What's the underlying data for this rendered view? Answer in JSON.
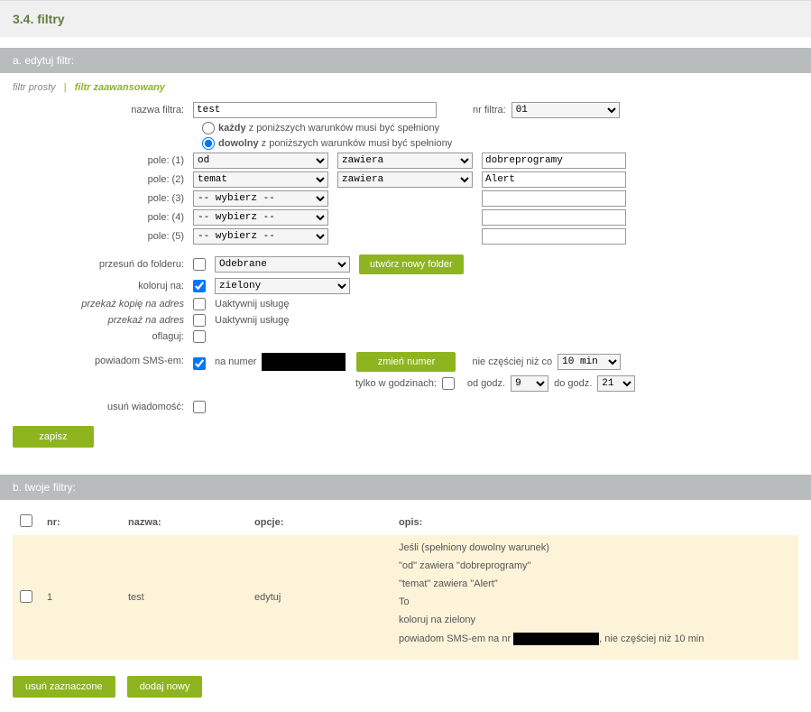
{
  "page": {
    "title": "3.4. filtry"
  },
  "sections": {
    "a_title": "a. edytuj filtr:",
    "b_title": "b. twoje filtry:"
  },
  "tabs": {
    "simple": "filtr prosty",
    "sep": "|",
    "advanced": "filtr zaawansowany"
  },
  "labels": {
    "filter_name": "nazwa filtra:",
    "filter_nr": "nr filtra:",
    "every": "każdy",
    "every_rest": " z poniższych warunków musi być spełniony",
    "any": "dowolny",
    "any_rest": " z poniższych warunków musi być spełniony",
    "field1": "pole: (1)",
    "field2": "pole: (2)",
    "field3": "pole: (3)",
    "field4": "pole: (4)",
    "field5": "pole: (5)",
    "move_to": "przesuń do folderu:",
    "color": "koloruj na:",
    "forward_copy": "przekaż kopię na adres",
    "forward": "przekaż na adres",
    "flag": "oflaguj:",
    "sms": "powiadom SMS-em:",
    "na_numer": "na numer",
    "tylko_godz": "tylko w godzinach:",
    "nie_czesciej": "nie częściej niż co",
    "od_godz": "od godz.",
    "do_godz": "do godz.",
    "delete_msg": "usuń wiadomość:",
    "activate": "Uaktywnij usługę"
  },
  "values": {
    "filter_name": "test",
    "filter_nr": "01",
    "field_opts": {
      "od": "od",
      "temat": "temat",
      "wybierz": "-- wybierz --"
    },
    "op_zawiera": "zawiera",
    "val1": "dobreprogramy",
    "val2": "Alert",
    "folder": "Odebrane",
    "color": "zielony",
    "freq": "10 min",
    "hour_from": "9",
    "hour_to": "21"
  },
  "buttons": {
    "new_folder": "utwórz nowy folder",
    "change_number": "zmień numer",
    "save": "zapisz",
    "delete_selected": "usuń zaznaczone",
    "add_new": "dodaj nowy"
  },
  "table": {
    "headers": {
      "nr": "nr:",
      "name": "nazwa:",
      "options": "opcje:",
      "desc": "opis:"
    },
    "row": {
      "nr": "1",
      "name": "test",
      "option": "edytuj",
      "desc_lines": [
        "Jeśli (spełniony dowolny warunek)",
        "\"od\" zawiera \"dobreprogramy\"",
        "\"temat\" zawiera \"Alert\"",
        "To",
        "koloruj na zielony"
      ],
      "desc_sms_pre": "powiadom SMS-em na nr",
      "desc_sms_post": ", nie częściej niż 10 min"
    }
  }
}
